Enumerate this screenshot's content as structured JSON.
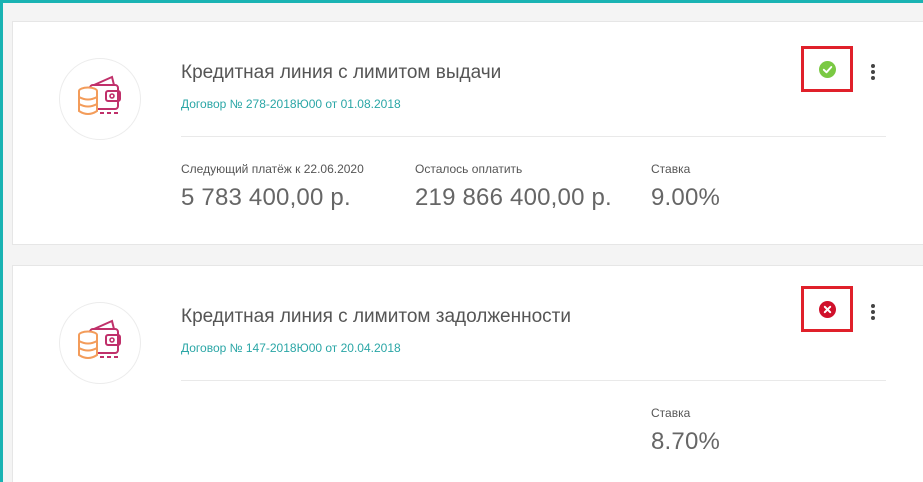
{
  "colors": {
    "accent": "#19b3b3",
    "link": "#2aa6a6",
    "status_ok": "#7ac943",
    "status_error": "#d0112b",
    "highlight_border": "#e0202a",
    "icon_orange": "#f39c5a",
    "icon_magenta": "#c0306a"
  },
  "loans": [
    {
      "title": "Кредитная линия с лимитом выдачи",
      "contract": "Договор № 278-2018Ю00 от 01.08.2018",
      "status_icon": "check-circle-icon",
      "next_payment_label": "Следующий платёж к 22.06.2020",
      "next_payment_value": "5 783 400,00 р.",
      "remaining_label": "Осталось оплатить",
      "remaining_value": "219 866 400,00 р.",
      "rate_label": "Ставка",
      "rate_value": "9.00%"
    },
    {
      "title": "Кредитная линия с лимитом задолженности",
      "contract": "Договор № 147-2018Ю00 от 20.04.2018",
      "status_icon": "error-circle-icon",
      "rate_label": "Ставка",
      "rate_value": "8.70%"
    }
  ]
}
